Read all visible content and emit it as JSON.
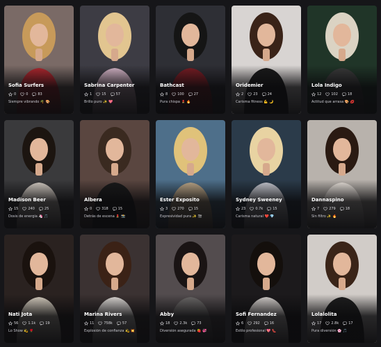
{
  "cards": [
    {
      "name": "Sofia Surfers",
      "stars": "0",
      "likes": "0",
      "msgs": "83",
      "desc": "Siempre vibrando 🌴 🎨",
      "bg": "#7a6a66",
      "accent": "#b1282f",
      "hair": "#c79a5a"
    },
    {
      "name": "Sabrina Carpenter",
      "stars": "1",
      "likes": "15",
      "msgs": "57",
      "desc": "Brillo puro ✨ 💖",
      "bg": "#3d3c44",
      "accent": "#d7b7c9",
      "hair": "#e2c590"
    },
    {
      "name": "Bathcast",
      "stars": "8",
      "likes": "100",
      "msgs": "27",
      "desc": "Pura chispa 💄 🔥",
      "bg": "#2e2f35",
      "accent": "#7a1d24",
      "hair": "#151515"
    },
    {
      "name": "Oridemier",
      "stars": "2",
      "likes": "23",
      "msgs": "24",
      "desc": "Carisma fitness 💪 🌙",
      "bg": "#d8d4d2",
      "accent": "#1a1a1a",
      "hair": "#3a2318"
    },
    {
      "name": "Lola Indigo",
      "stars": "12",
      "likes": "102",
      "msgs": "18",
      "desc": "Actitud que arrasa 🎨 💋",
      "bg": "#203528",
      "accent": "#3a3a3a",
      "hair": "#dbd3c3"
    },
    {
      "name": "Madison Beer",
      "stars": "15",
      "likes": "240",
      "msgs": "25",
      "desc": "Dosis de energía 🦄 🎵",
      "bg": "#3a3a3c",
      "accent": "#d7cfc6",
      "hair": "#1c1510"
    },
    {
      "name": "Albera",
      "stars": "0",
      "likes": "318",
      "msgs": "15",
      "desc": "Detrás de escena 💄 📸",
      "bg": "#5a4640",
      "accent": "#1a1a1a",
      "hair": "#3a2a20"
    },
    {
      "name": "Ester Exposito",
      "stars": "3",
      "likes": "270",
      "msgs": "15",
      "desc": "Expresividad pura ✨ 🎬",
      "bg": "#4e6f8a",
      "accent": "#bea98a",
      "hair": "#e0c27a"
    },
    {
      "name": "Sydney Sweeney",
      "stars": "23",
      "likes": "0.7k",
      "msgs": "15",
      "desc": "Carisma natural ❤️ 💎",
      "bg": "#2b3b4a",
      "accent": "#c9cbd3",
      "hair": "#e8d3a2"
    },
    {
      "name": "Dannaspino",
      "stars": "7",
      "likes": "279",
      "msgs": "18",
      "desc": "Sin filtro ✨ 🔥",
      "bg": "#b8b2ac",
      "accent": "#eae3dc",
      "hair": "#2a1a12"
    },
    {
      "name": "Nati Jota",
      "stars": "56",
      "likes": "1.1k",
      "msgs": "19",
      "desc": "Lo Show 💫 🌹",
      "bg": "#2a2220",
      "accent": "#dcd3c4",
      "hair": "#1a120e"
    },
    {
      "name": "Marina Rivers",
      "stars": "11",
      "likes": "758k",
      "msgs": "57",
      "desc": "Explosión de confianza 💫 💥",
      "bg": "#3b3232",
      "accent": "#e4e0dc",
      "hair": "#3b2216"
    },
    {
      "name": "Abby",
      "stars": "18",
      "likes": "2.3k",
      "msgs": "73",
      "desc": "Diversión asegurada 🍓 💞",
      "bg": "#534c4e",
      "accent": "#6e6b6a",
      "hair": "#1a1414"
    },
    {
      "name": "Sofi Fernandez",
      "stars": "6",
      "likes": "292",
      "msgs": "16",
      "desc": "Estilo profesional 💖 👠",
      "bg": "#1c1a1c",
      "accent": "#d9d4d0",
      "hair": "#140f0c"
    },
    {
      "name": "Lolalolita",
      "stars": "17",
      "likes": "2.8k",
      "msgs": "17",
      "desc": "Pura diversión 🌸 🎵",
      "bg": "#d1ccc8",
      "accent": "#1e1e1e",
      "hair": "#3a2418"
    }
  ]
}
